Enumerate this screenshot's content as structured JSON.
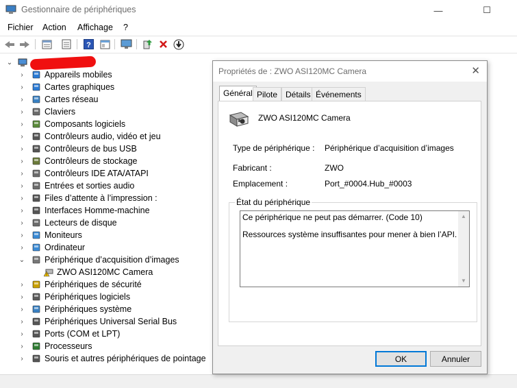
{
  "window": {
    "title": "Gestionnaire de périphériques",
    "app_icon": "device-manager-icon",
    "controls": {
      "minimize": "—",
      "maximize": "☐"
    }
  },
  "menu": [
    "Fichier",
    "Action",
    "Affichage",
    "?"
  ],
  "toolbar": [
    "back-arrow-icon",
    "forward-arrow-icon",
    "properties-icon",
    "update-icon",
    "help-icon",
    "view-icon",
    "monitor-icon",
    "add-driver-icon",
    "uninstall-icon",
    "download-icon"
  ],
  "tree": {
    "root_icon": "computer-icon",
    "items": [
      {
        "label": "Appareils mobiles",
        "icon": "mobile-device-icon",
        "expander": "›"
      },
      {
        "label": "Cartes graphiques",
        "icon": "display-adapter-icon",
        "expander": "›"
      },
      {
        "label": "Cartes réseau",
        "icon": "network-adapter-icon",
        "expander": "›"
      },
      {
        "label": "Claviers",
        "icon": "keyboard-icon",
        "expander": "›"
      },
      {
        "label": "Composants logiciels",
        "icon": "software-component-icon",
        "expander": "›"
      },
      {
        "label": "Contrôleurs audio, vidéo et jeu",
        "icon": "audio-icon",
        "expander": "›"
      },
      {
        "label": "Contrôleurs de bus USB",
        "icon": "usb-icon",
        "expander": "›"
      },
      {
        "label": "Contrôleurs de stockage",
        "icon": "storage-controller-icon",
        "expander": "›"
      },
      {
        "label": "Contrôleurs IDE ATA/ATAPI",
        "icon": "ide-icon",
        "expander": "›"
      },
      {
        "label": "Entrées et sorties audio",
        "icon": "speaker-icon",
        "expander": "›"
      },
      {
        "label": "Files d’attente à l’impression :",
        "icon": "printer-icon",
        "expander": "›"
      },
      {
        "label": "Interfaces Homme-machine",
        "icon": "hid-icon",
        "expander": "›"
      },
      {
        "label": "Lecteurs de disque",
        "icon": "disk-drive-icon",
        "expander": "›"
      },
      {
        "label": "Moniteurs",
        "icon": "monitor-icon",
        "expander": "›"
      },
      {
        "label": "Ordinateur",
        "icon": "computer-icon",
        "expander": "›"
      },
      {
        "label": "Périphérique d’acquisition d’images",
        "icon": "camera-icon",
        "expander": "⌄"
      },
      {
        "label": "ZWO ASI120MC Camera",
        "icon": "warning-camera-icon",
        "expander": "",
        "child": true
      },
      {
        "label": "Périphériques de sécurité",
        "icon": "security-device-icon",
        "expander": "›"
      },
      {
        "label": "Périphériques logiciels",
        "icon": "software-device-icon",
        "expander": "›"
      },
      {
        "label": "Périphériques système",
        "icon": "system-device-icon",
        "expander": "›"
      },
      {
        "label": "Périphériques Universal Serial Bus",
        "icon": "usb-device-icon",
        "expander": "›"
      },
      {
        "label": "Ports (COM et LPT)",
        "icon": "port-icon",
        "expander": "›"
      },
      {
        "label": "Processeurs",
        "icon": "processor-icon",
        "expander": "›"
      },
      {
        "label": "Souris et autres périphériques de pointage",
        "icon": "mouse-icon",
        "expander": "›"
      }
    ]
  },
  "dialog": {
    "title": "Propriétés de : ZWO ASI120MC Camera",
    "close": "✕",
    "tabs": [
      "Général",
      "Pilote",
      "Détails",
      "Événements"
    ],
    "active_tab": "Général",
    "device_name": "ZWO ASI120MC Camera",
    "device_icon": "camera-icon",
    "fields": {
      "type_label": "Type de périphérique :",
      "type_value": "Périphérique d’acquisition d’images",
      "maker_label": "Fabricant :",
      "maker_value": "ZWO",
      "location_label": "Emplacement :",
      "location_value": "Port_#0004.Hub_#0003"
    },
    "status": {
      "legend": "État du périphérique",
      "line1": "Ce périphérique ne peut pas démarrer. (Code 10)",
      "line2": "Ressources système insuffisantes pour mener à bien l’API."
    },
    "buttons": {
      "ok": "OK",
      "cancel": "Annuler"
    }
  },
  "colors": {
    "accent": "#0078d7",
    "warning": "#f5c400",
    "redaction": "#f01010"
  }
}
